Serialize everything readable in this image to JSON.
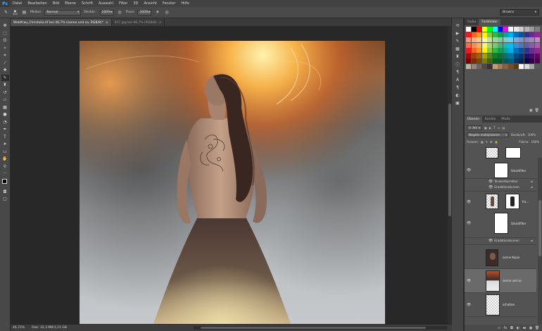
{
  "app": {
    "logo": "Ps"
  },
  "menu": [
    "Datei",
    "Bearbeiten",
    "Bild",
    "Ebene",
    "Schrift",
    "Auswahl",
    "Filter",
    "3D",
    "Ansicht",
    "Fenster",
    "Hilfe"
  ],
  "options": {
    "brush_size": "300",
    "mode_label": "Modus:",
    "mode_value": "Normal",
    "opacity_label": "Deckkr.:",
    "opacity_value": "100%",
    "flow_label": "Fluss:",
    "flow_value": "100%"
  },
  "workspace": {
    "value": "Browns"
  },
  "tabs": [
    {
      "label": "Waldfrau_Christolia.tif bei 46,7% (sonne und so, RGB/8)*",
      "close": "×"
    },
    {
      "label": "017.jpg bei 66,7% (RGB/8)",
      "close": "×"
    }
  ],
  "status": {
    "zoom": "46,72%",
    "doc": "Dok: 32,3 MB/1,21 GB"
  },
  "panels": {
    "color_tabs": [
      "Farbe",
      "Farbfelder"
    ],
    "layer_tabs": [
      "Ebenen",
      "Kanäle",
      "Pfade"
    ],
    "filter_label": "Art",
    "blend_mode": "Negativ multiplizieren",
    "opacity_label": "Deckkraft:",
    "opacity_value": "100%",
    "lock_label": "Fixieren:",
    "fill_label": "Fläche:",
    "fill_value": "100%"
  },
  "layers": [
    {
      "name": "Smartfilter"
    },
    {
      "name": "Tonwertkorrektur"
    },
    {
      "name": "Gradationskurven"
    },
    {
      "name": "fra..."
    },
    {
      "name": "Smartfilter"
    },
    {
      "name": "Gradationskurven"
    },
    {
      "name": "sonne Kopie"
    },
    {
      "name": "sonne und so"
    },
    {
      "name": "schatten"
    }
  ],
  "colors": {
    "accent": "#4ea9f5",
    "panel_bg": "#535353",
    "selected_layer": "#6a6a6a"
  },
  "swatch_colors": [
    "#ffffff",
    "#000000",
    "#ff0000",
    "#ffff00",
    "#00ff00",
    "#00ffff",
    "#0000ff",
    "#ff00ff",
    "#ffffff",
    "#e6e6e6",
    "#cccccc",
    "#b3b3b3",
    "#999999",
    "#808080",
    "#ed1c24",
    "#f26522",
    "#f7941d",
    "#fff200",
    "#8dc63f",
    "#39b54a",
    "#00a651",
    "#00a99d",
    "#00aeef",
    "#0072bc",
    "#0054a6",
    "#2e3192",
    "#662d91",
    "#92278f",
    "#f7977a",
    "#f9ad81",
    "#fdc68a",
    "#fff79a",
    "#c4df9b",
    "#a3d39c",
    "#82ca9d",
    "#7bcdc8",
    "#6ecff6",
    "#7ea7d8",
    "#8493ca",
    "#8882be",
    "#a187be",
    "#bc8dbf",
    "#f26c4f",
    "#f68e56",
    "#fbaf5d",
    "#fff467",
    "#acd372",
    "#7cc576",
    "#3bb878",
    "#1abbb4",
    "#00bff3",
    "#448ccb",
    "#5574b9",
    "#605ca8",
    "#8560a8",
    "#a763a8",
    "#ed1c24",
    "#f26522",
    "#f7941d",
    "#fff200",
    "#8dc63f",
    "#39b54a",
    "#00a651",
    "#00a99d",
    "#00aeef",
    "#0072bc",
    "#0054a6",
    "#2e3192",
    "#662d91",
    "#92278f",
    "#9e0b0f",
    "#a0410d",
    "#a36209",
    "#aba000",
    "#598527",
    "#1a7b30",
    "#007236",
    "#00746b",
    "#0076a3",
    "#004b80",
    "#003471",
    "#1b1464",
    "#440e62",
    "#630460",
    "#790000",
    "#7b2e00",
    "#7d4900",
    "#827b00",
    "#406618",
    "#005e20",
    "#005826",
    "#005952",
    "#005b7f",
    "#003663",
    "#002157",
    "#0d004c",
    "#32004b",
    "#4b0049",
    "#c7b299",
    "#998675",
    "#736357",
    "#534741",
    "#37302d",
    "#c69c6d",
    "#a67c52",
    "#8c6239",
    "#754c24",
    "#603913",
    "#ffffff",
    "#d9d9d9",
    "#a6a6a6",
    "#595959"
  ]
}
